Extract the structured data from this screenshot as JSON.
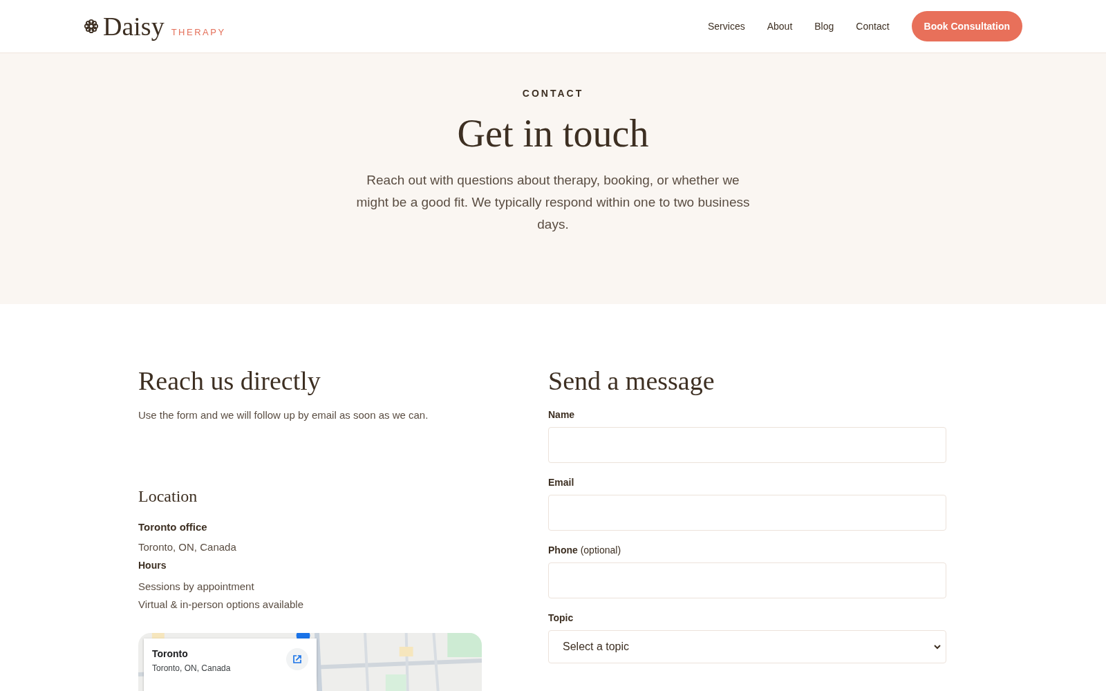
{
  "header": {
    "logo": {
      "name": "Daisy",
      "tagline": "THERAPY"
    },
    "nav": [
      {
        "label": "Services"
      },
      {
        "label": "About"
      },
      {
        "label": "Blog"
      },
      {
        "label": "Contact"
      }
    ],
    "cta": "Book Consultation"
  },
  "hero": {
    "eyebrow": "CONTACT",
    "title": "Get in touch",
    "intro": "Reach out with questions about therapy, booking, or whether we might be a good fit. We typically respond within one to two business days."
  },
  "direct": {
    "title": "Reach us directly",
    "text": "Use the form and we will follow up by email as soon as we can."
  },
  "location": {
    "title": "Location",
    "office_label": "Toronto office",
    "office_address": "Toronto, ON, Canada",
    "hours_label": "Hours",
    "hours_lines": [
      "Sessions by appointment",
      "Virtual & in-person options available"
    ]
  },
  "map": {
    "kind": "picture",
    "place_title": "Toronto",
    "place_address": "Toronto, ON, Canada"
  },
  "form": {
    "title": "Send a message",
    "fields": [
      {
        "kind": "text",
        "label": "Name"
      },
      {
        "kind": "text",
        "label": "Email"
      },
      {
        "kind": "text",
        "label": "Phone",
        "note": "(optional)"
      },
      {
        "kind": "select",
        "label": "Topic",
        "value": "Select a topic"
      }
    ]
  }
}
